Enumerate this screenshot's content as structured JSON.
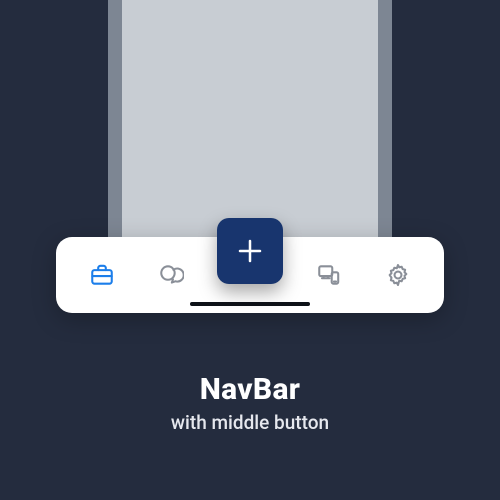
{
  "caption": {
    "title": "NavBar",
    "subtitle": "with middle button"
  },
  "navbar": {
    "items": [
      {
        "name": "briefcase",
        "active": true
      },
      {
        "name": "chat",
        "active": false
      },
      {
        "name": "devices",
        "active": false
      },
      {
        "name": "settings",
        "active": false
      }
    ],
    "center_button": {
      "name": "add"
    }
  },
  "colors": {
    "background": "#242c3e",
    "navbar_bg": "#ffffff",
    "center_button_bg": "#18356e",
    "active_icon": "#1c7eea",
    "inactive_icon": "#8a8f98"
  }
}
